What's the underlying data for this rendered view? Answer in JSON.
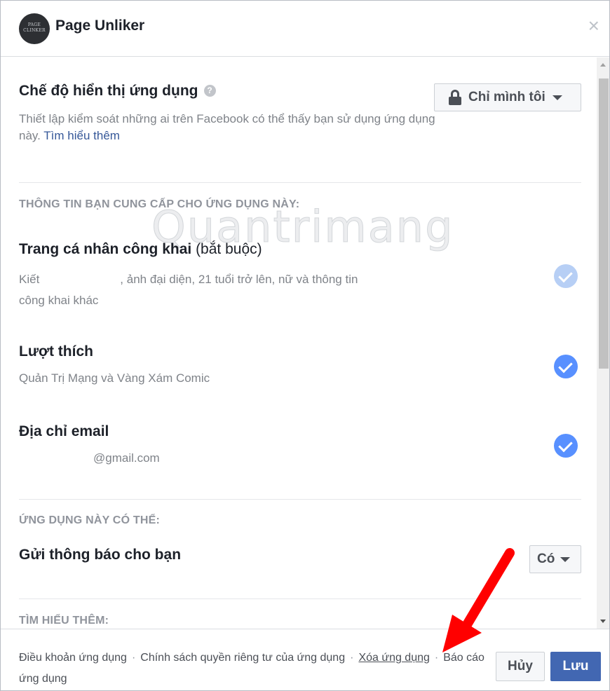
{
  "window": {
    "logo_text": "PAGE\nCLINKER",
    "title": "Page Unliker",
    "close_glyph": "×"
  },
  "visibility": {
    "heading": "Chế độ hiển thị ứng dụng",
    "help_glyph": "?",
    "description": "Thiết lập kiểm soát những ai trên Facebook có thể thấy bạn sử dụng ứng dụng này.",
    "learn_more": "Tìm hiểu thêm",
    "audience_value": "Chỉ mình tôi"
  },
  "info_section": {
    "heading": "THÔNG TIN BẠN CUNG CẤP CHO ỨNG DỤNG NÀY:",
    "items": [
      {
        "title": "Trang cá nhân công khai",
        "title_suffix": "(bắt buộc)",
        "detail_start": "Kiết",
        "detail_end": ", ảnh đại diện, 21 tuổi trở lên, nữ và thông tin",
        "detail_line2": "công khai khác",
        "checked": true,
        "required": true
      },
      {
        "title": "Lượt thích",
        "detail": "Quản Trị Mạng và Vàng Xám Comic",
        "checked": true
      },
      {
        "title": "Địa chỉ email",
        "detail": "@gmail.com",
        "checked": true
      }
    ]
  },
  "permissions_section": {
    "heading": "ỨNG DỤNG NÀY CÓ THỂ:",
    "notify_label": "Gửi thông báo cho bạn",
    "notify_value": "Có"
  },
  "learn_more_section": {
    "heading": "TÌM HIỂU THÊM:"
  },
  "watermark": "Quantrimang",
  "footer": {
    "links": [
      "Điều khoản ứng dụng",
      "Chính sách quyền riêng tư của ứng dụng",
      "Xóa ứng dụng",
      "Báo cáo ứng dụng"
    ],
    "separator": "·",
    "cancel_label": "Hủy",
    "save_label": "Lưu"
  },
  "colors": {
    "primary_button": "#4267b2",
    "check_active": "#5890ff",
    "link": "#365899",
    "annotation_arrow": "#ff0000"
  }
}
